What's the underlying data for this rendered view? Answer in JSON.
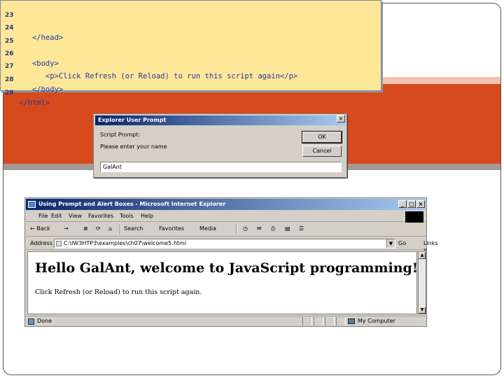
{
  "code": {
    "lines": [
      {
        "n": "23",
        "text": ""
      },
      {
        "n": "24",
        "text": "   </head>"
      },
      {
        "n": "25",
        "text": ""
      },
      {
        "n": "26",
        "text": "   <body>"
      },
      {
        "n": "27",
        "text": "      <p>Click Refresh (or Reload) to run this script again</p>"
      },
      {
        "n": "28",
        "text": "   </body>"
      },
      {
        "n": "29",
        "text": "</html>"
      }
    ]
  },
  "dialog": {
    "title": "Explorer User Prompt",
    "close": "×",
    "script_prompt": "Script Prompt:",
    "message": "Please enter your name",
    "ok": "OK",
    "cancel": "Cancel",
    "input_value": "GalAnt"
  },
  "browser": {
    "title": "Using Prompt and Alert Boxes - Microsoft Internet Explorer",
    "minimize": "_",
    "maximize": "□",
    "close": "×",
    "menu": [
      "File",
      "Edit",
      "View",
      "Favorites",
      "Tools",
      "Help"
    ],
    "toolbar": {
      "back": "← Back",
      "forward": "→",
      "stop": "⊗",
      "refresh": "⟳",
      "home": "⌂",
      "search": "Search",
      "favorites": "Favorites",
      "media": "Media",
      "history": "◷",
      "mail": "✉",
      "print": "⎙",
      "edit": "▤",
      "discuss": "☰"
    },
    "address_label": "Address",
    "address": "C:\\IW3HTP3\\examples\\ch07\\welcome5.html",
    "go": "Go",
    "links": "Links »",
    "page_heading": "Hello GalAnt, welcome to JavaScript programming!",
    "page_paragraph": "Click Refresh (or Reload) to run this script again.",
    "scroll_up": "▲",
    "scroll_down": "▼",
    "status": "Done",
    "zone": "My Computer"
  }
}
